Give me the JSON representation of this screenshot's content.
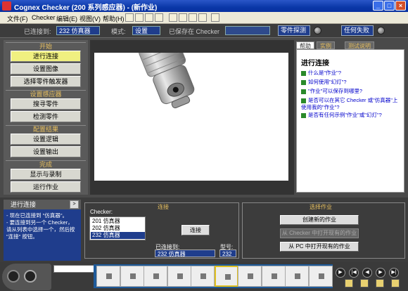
{
  "window": {
    "title": "Cognex Checker (200 系列感应器) - (新作业)",
    "minimize_glyph": "_",
    "maximize_glyph": "□",
    "close_glyph": "×"
  },
  "menu": [
    {
      "label": "文件(F)"
    },
    {
      "label": "Checker"
    },
    {
      "label": "编辑(E)"
    },
    {
      "label": "视图(V)"
    },
    {
      "label": "帮助(H)"
    }
  ],
  "status": {
    "connected_label": "已连接到:",
    "connected_value": "232 仿真器",
    "mode_label": "模式:",
    "mode_value": "设置",
    "job_label": "已保存在 Checker",
    "job_value": "",
    "part_detect_label": "零件探测",
    "any_fail_label": "任何失败"
  },
  "left_panel": {
    "sections": [
      {
        "title": "开始",
        "buttons": [
          "进行连接",
          "设置图像",
          "选择零件触发器"
        ]
      },
      {
        "title": "设置感应器",
        "buttons": [
          "搜寻零件",
          "检测零件"
        ]
      },
      {
        "title": "配置结果",
        "buttons": [
          "设置逻辑",
          "设置输出"
        ]
      },
      {
        "title": "完成",
        "buttons": [
          "显示与录制",
          "运行作业"
        ]
      }
    ]
  },
  "help": {
    "tabs": [
      "帮助",
      "实例",
      "测试说明"
    ],
    "title": "进行连接",
    "links": [
      "什么是\"作业\"?",
      "如何使用\"幻灯\"?",
      "\"作业\"可以保存到哪里?",
      "是否可以在其它 Checker 或\"仿真器\"上使用我的\"作业\"?",
      "是否有任何示例\"作业\"或\"幻灯\"?"
    ]
  },
  "step": {
    "header": "进行连接",
    "next": ">",
    "description": "- 现在已连接到 \"仿真器\"。\n- 要连接到另一个 Checker，请从列表中选择一个，然后按 \"连接\" 按钮。"
  },
  "connect": {
    "title": "连接",
    "list_label": "Checker:",
    "items": [
      "201 仿真器",
      "202 仿真器",
      "232 仿真器"
    ],
    "selected_index": 2,
    "connect_button": "连接",
    "connected_to_label": "已连接到:",
    "connected_to_value": "232 仿真器",
    "model_label": "型号:",
    "model_value": "232"
  },
  "job": {
    "title": "选择作业",
    "buttons": [
      {
        "label": "创建新的作业",
        "enabled": true
      },
      {
        "label": "从 Checker 中打开现有的作业",
        "enabled": false
      },
      {
        "label": "从 PC 中打开现有的作业",
        "enabled": true
      }
    ]
  },
  "filmstrip": {
    "frames": 10,
    "highlight_index": 5
  }
}
